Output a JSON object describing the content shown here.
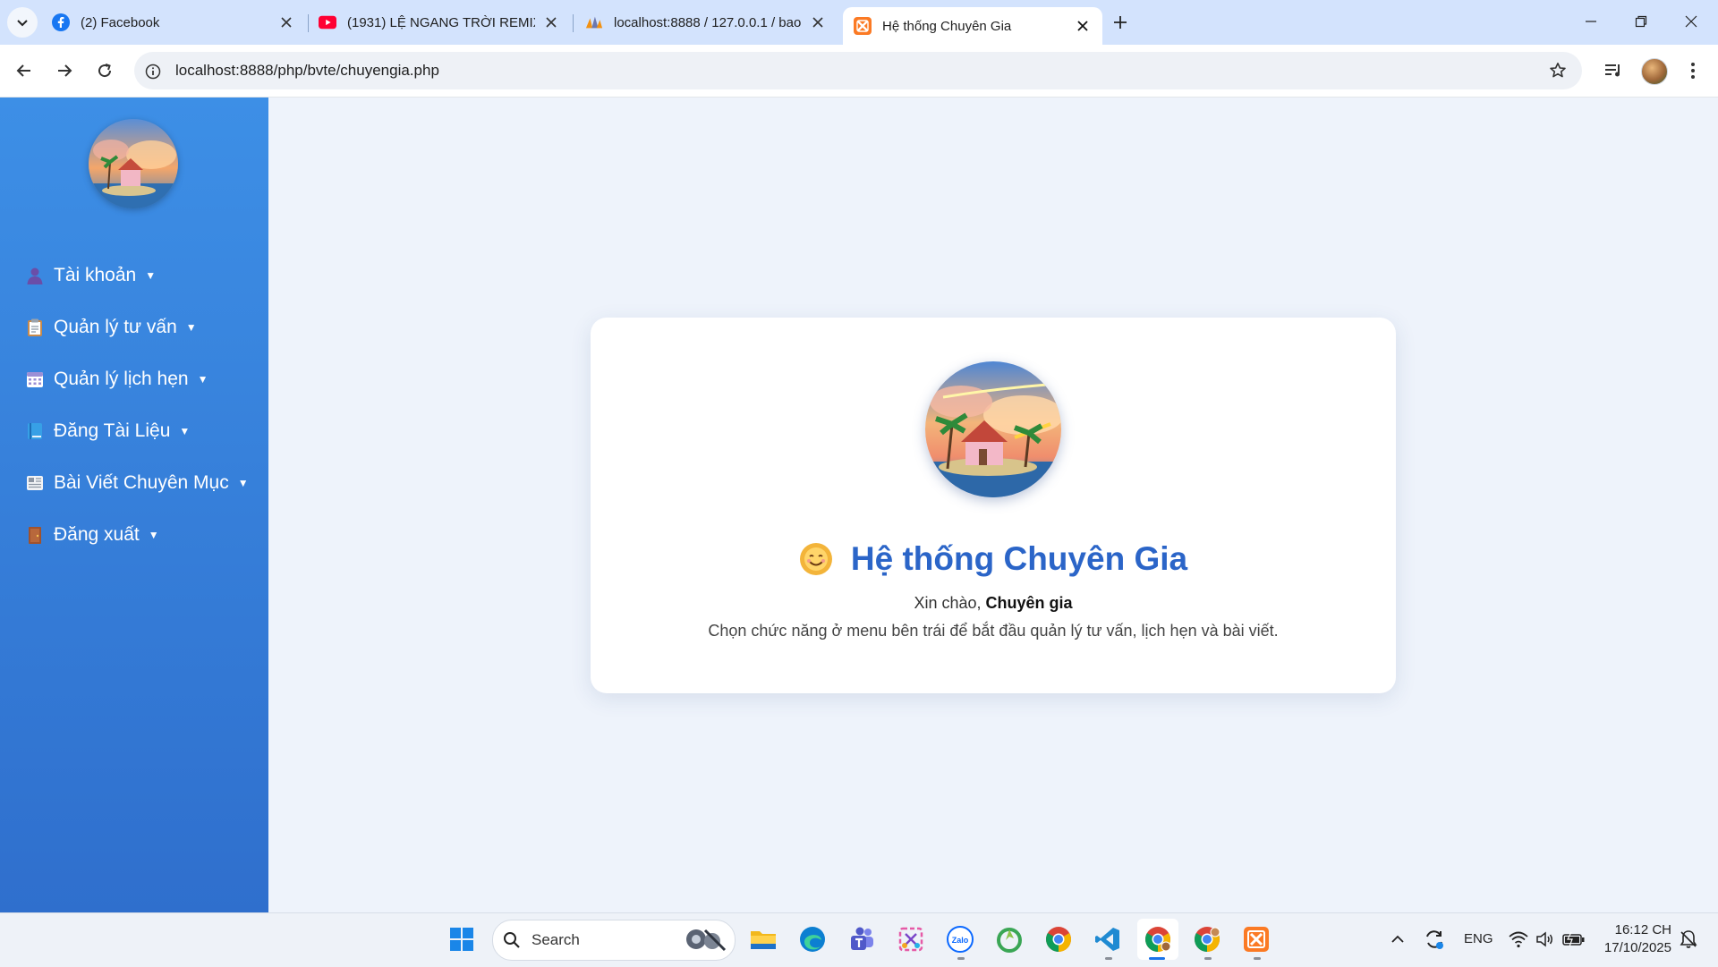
{
  "browser": {
    "tabs": [
      {
        "title": "(2) Facebook",
        "icon": "facebook-icon"
      },
      {
        "title": "(1931) LỆ NGANG TRỜI REMIX I",
        "icon": "youtube-icon"
      },
      {
        "title": "localhost:8888 / 127.0.0.1 / bao",
        "icon": "phpmyadmin-icon"
      },
      {
        "title": "Hệ thống Chuyên Gia",
        "icon": "xampp-icon",
        "active": true
      }
    ],
    "url": "localhost:8888/php/bvte/chuyengia.php"
  },
  "sidebar": {
    "items": [
      {
        "label": "Tài khoản",
        "icon": "user-icon"
      },
      {
        "label": "Quản lý tư vấn",
        "icon": "clipboard-icon"
      },
      {
        "label": "Quản lý lịch hẹn",
        "icon": "calendar-icon"
      },
      {
        "label": "Đăng Tài Liệu",
        "icon": "book-icon"
      },
      {
        "label": "Bài Viết Chuyên Mục",
        "icon": "newspaper-icon"
      },
      {
        "label": "Đăng xuất",
        "icon": "door-icon"
      }
    ]
  },
  "card": {
    "title": "Hệ thống Chuyên Gia",
    "greeting_prefix": "Xin chào,",
    "user_name": "Chuyên gia",
    "description": "Chọn chức năng ở menu bên trái để bắt đầu quản lý tư vấn, lịch hẹn và bài viết."
  },
  "taskbar": {
    "search_label": "Search",
    "language": "ENG",
    "time": "16:12 CH",
    "date": "17/10/2025"
  },
  "colors": {
    "sidebar_top": "#3d8fe6",
    "sidebar_bottom": "#2f6fcd",
    "title": "#2b65c8",
    "page_bg": "#eef3fb"
  }
}
